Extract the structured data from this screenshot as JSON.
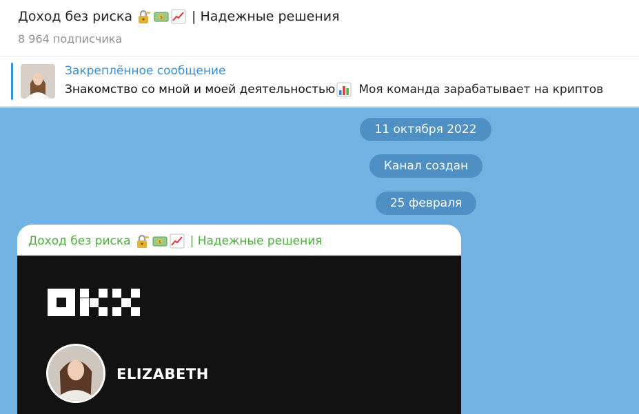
{
  "header": {
    "channel_title": "Доход без риска",
    "title_suffix": "| Надежные решения",
    "subscribers": "8 964 подписчика",
    "title_emojis": [
      "lock-with-key-icon",
      "money-bill-icon",
      "chart-increasing-icon"
    ]
  },
  "pinned": {
    "label": "Закреплённое сообщение",
    "text_bold": "Знакомство со мной и моей деятельностью",
    "text_rest": "Моя команда зарабатывает на криптов",
    "emoji": "bar-chart-icon"
  },
  "chat": {
    "date_pills": [
      "11 октября 2022",
      "Канал создан",
      "25 февраля"
    ],
    "message": {
      "author_name": "Доход без риска",
      "author_suffix": "| Надежные решения",
      "media": {
        "logo": "OKX",
        "profile_name": "ELIZABETH"
      }
    }
  },
  "colors": {
    "chat_background": "#72b2e0",
    "pill_background": "#4e8fc4",
    "pinned_accent": "#3a95d6",
    "author_color": "#4cae3d",
    "media_background": "#121212"
  }
}
